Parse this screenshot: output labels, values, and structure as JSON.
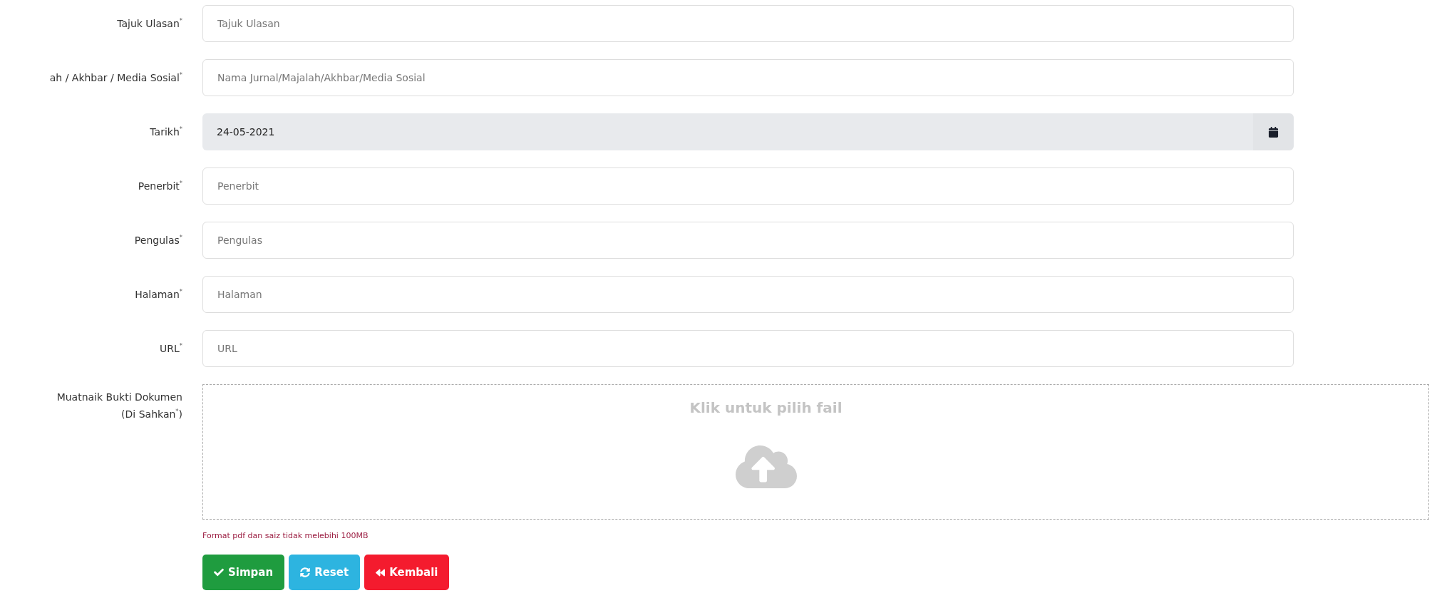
{
  "fields": [
    {
      "label": "Tajuk Ulasan$^{*}$",
      "kind": "text",
      "placeholder": "Tajuk Ulasan"
    },
    {
      "label": "ah / Akhbar / Media Sosial$^{*}$",
      "kind": "text",
      "placeholder": "Nama Jurnal/Majalah/Akhbar/Media Sosial"
    },
    {
      "label": "Tarikh$^{*}$",
      "kind": "date",
      "value": "24-05-2021"
    },
    {
      "label": "Penerbit$^{*}$",
      "kind": "text",
      "placeholder": "Penerbit"
    },
    {
      "label": "Pengulas$^{*}$",
      "kind": "text",
      "placeholder": "Pengulas"
    },
    {
      "label": "Halaman$^{*}$",
      "kind": "text",
      "placeholder": "Halaman"
    },
    {
      "label": "URL$^{*}$",
      "kind": "text",
      "placeholder": "URL"
    }
  ],
  "upload": {
    "label_lines": [
      "Muatnaik Bukti Dokumen",
      "(Di Sahkan$^{*}$)"
    ],
    "prompt": "Klik untuk pilih fail",
    "note": "Format pdf dan saiz tidak melebihi 100MB"
  },
  "buttons": [
    {
      "label": "Simpan",
      "kind": "save"
    },
    {
      "label": "Reset",
      "kind": "reset"
    },
    {
      "label": "Kembali",
      "kind": "back"
    }
  ]
}
